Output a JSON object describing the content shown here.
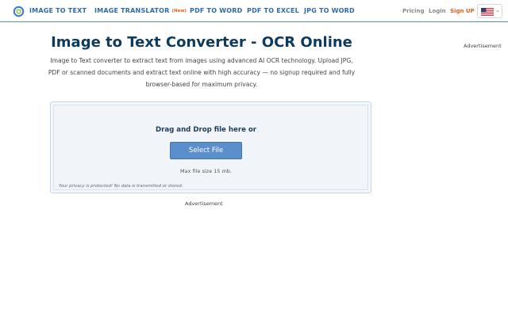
{
  "header": {
    "brand": "IMAGE TO TEXT",
    "nav": [
      {
        "label": "IMAGE TRANSLATOR",
        "badge": "(New)"
      },
      {
        "label": "PDF TO WORD"
      },
      {
        "label": "PDF TO EXCEL"
      },
      {
        "label": "JPG TO WORD"
      }
    ],
    "pricing": "Pricing",
    "login": "Login",
    "signup": "Sign UP",
    "language_flag": "us-flag-icon"
  },
  "main": {
    "title": "Image to Text Converter - OCR Online",
    "description": "Image to Text converter to extract text from images using advanced AI OCR technology. Upload JPG, PDF or scanned documents and extract text online with high accuracy — no signup required and fully browser-based for maximum privacy.",
    "ad_right": "Advertisement"
  },
  "upload": {
    "drop_text": "Drag and Drop file here or",
    "select_button": "Select File",
    "max_size": "Max file size 15 mb.",
    "privacy": "Your privacy is protected! No data is transmitted or stored.",
    "ad_bottom": "Advertisement"
  },
  "colors": {
    "brand_blue": "#2f6aa8",
    "title_navy": "#0d3a5f",
    "accent_orange": "#e8601c",
    "button_blue": "#5b8fcb"
  }
}
